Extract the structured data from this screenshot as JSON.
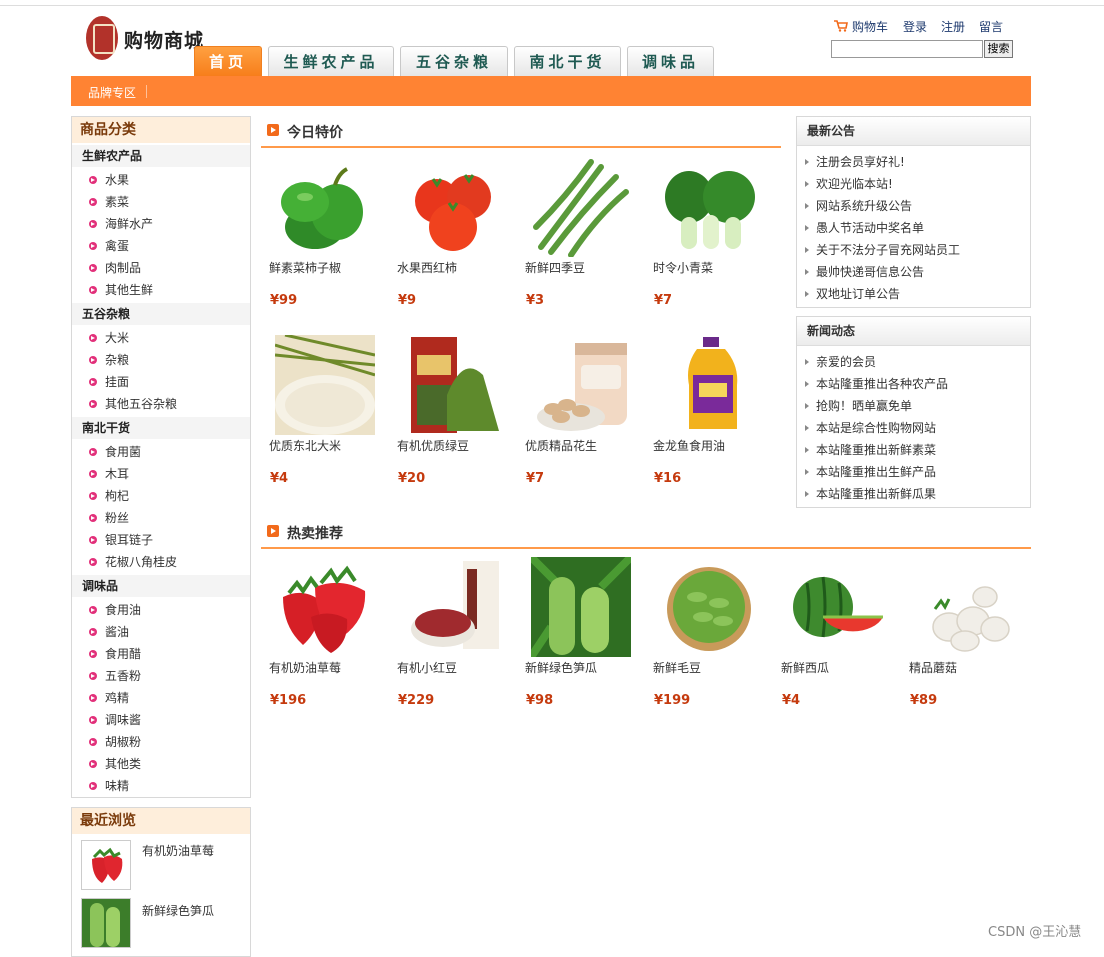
{
  "header": {
    "logo_text": "购物商城",
    "nav_tabs": [
      "首页",
      "生鲜农产品",
      "五谷杂粮",
      "南北干货",
      "调味品"
    ],
    "top_links": {
      "cart": "购物车",
      "login": "登录",
      "register": "注册",
      "message": "留言"
    },
    "search_button": "搜索",
    "search_value": ""
  },
  "subnav": {
    "item": "品牌专区"
  },
  "categories": {
    "title": "商品分类",
    "groups": [
      {
        "name": "生鲜农产品",
        "items": [
          "水果",
          "素菜",
          "海鲜水产",
          "禽蛋",
          "肉制品",
          "其他生鲜"
        ]
      },
      {
        "name": "五谷杂粮",
        "items": [
          "大米",
          "杂粮",
          "挂面",
          "其他五谷杂粮"
        ]
      },
      {
        "name": "南北干货",
        "items": [
          "食用菌",
          "木耳",
          "枸杞",
          "粉丝",
          "银耳链子",
          "花椒八角桂皮"
        ]
      },
      {
        "name": "调味品",
        "items": [
          "食用油",
          "酱油",
          "食用醋",
          "五香粉",
          "鸡精",
          "调味酱",
          "胡椒粉",
          "其他类",
          "味精"
        ]
      }
    ]
  },
  "recent": {
    "title": "最近浏览",
    "items": [
      "有机奶油草莓",
      "新鲜绿色笋瓜"
    ]
  },
  "specials": {
    "title": "今日特价",
    "products": [
      {
        "name": "鲜素菜柿子椒",
        "price": "¥99",
        "icon": "green-pepper"
      },
      {
        "name": "水果西红柿",
        "price": "¥9",
        "icon": "tomato"
      },
      {
        "name": "新鲜四季豆",
        "price": "¥3",
        "icon": "green-beans"
      },
      {
        "name": "时令小青菜",
        "price": "¥7",
        "icon": "bok-choy"
      },
      {
        "name": "优质东北大米",
        "price": "¥4",
        "icon": "rice"
      },
      {
        "name": "有机优质绿豆",
        "price": "¥20",
        "icon": "mung-beans"
      },
      {
        "name": "优质精品花生",
        "price": "¥7",
        "icon": "peanuts"
      },
      {
        "name": "金龙鱼食用油",
        "price": "¥16",
        "icon": "cooking-oil"
      }
    ]
  },
  "hot": {
    "title": "热卖推荐",
    "products": [
      {
        "name": "有机奶油草莓",
        "price": "¥196",
        "icon": "strawberry"
      },
      {
        "name": "有机小红豆",
        "price": "¥229",
        "icon": "red-beans"
      },
      {
        "name": "新鲜绿色笋瓜",
        "price": "¥98",
        "icon": "zucchini"
      },
      {
        "name": "新鲜毛豆",
        "price": "¥199",
        "icon": "edamame"
      },
      {
        "name": "新鲜西瓜",
        "price": "¥4",
        "icon": "watermelon"
      },
      {
        "name": "精品蘑菇",
        "price": "¥89",
        "icon": "mushroom"
      }
    ]
  },
  "announcements": {
    "title": "最新公告",
    "items": [
      "注册会员享好礼!",
      "欢迎光临本站!",
      "网站系统升级公告",
      "愚人节活动中奖名单",
      "关于不法分子冒充网站员工",
      "最帅快递哥信息公告",
      "双地址订单公告"
    ]
  },
  "news": {
    "title": "新闻动态",
    "items": [
      "亲爱的会员",
      "本站隆重推出各种农产品",
      "抢购！晒单赢免单",
      "本站是综合性购物网站",
      "本站隆重推出新鲜素菜",
      "本站隆重推出生鲜产品",
      "本站隆重推出新鲜瓜果"
    ]
  },
  "watermark": "CSDN @王沁慧",
  "colors": {
    "accent": "#ff8333",
    "price": "#c53a0e",
    "nav_text": "#1f5a52"
  }
}
